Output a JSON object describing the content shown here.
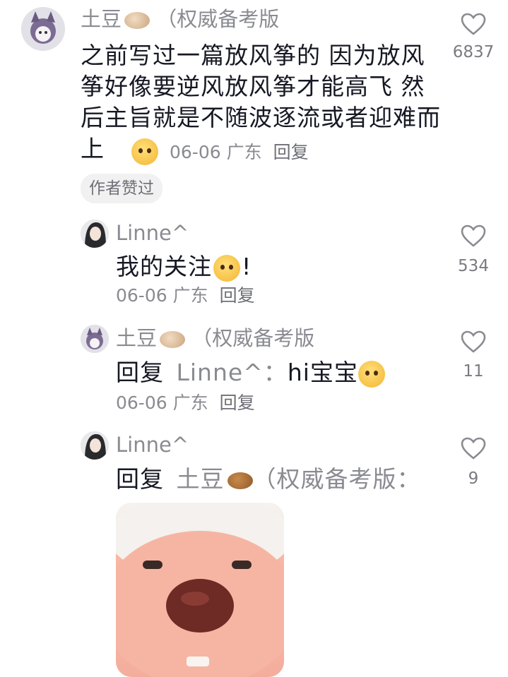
{
  "comments": [
    {
      "user": "土豆",
      "badge": "（权威备考版",
      "text": "之前写过一篇放风筝的 因为放风筝好像要逆风放风筝才能高飞 然后主旨就是不随波逐流或者迎难而上",
      "date": "06-06",
      "location": "广东",
      "reply_label": "回复",
      "tag": "作者赞过",
      "likes": "6837"
    },
    {
      "user": "Linne^",
      "text": "我的关注",
      "text_suffix": "!",
      "date": "06-06",
      "location": "广东",
      "reply_label": "回复",
      "likes": "534"
    },
    {
      "user": "土豆",
      "badge": "（权威备考版",
      "reply_prefix": "回复",
      "reply_target": "Linne^：",
      "text": "hi宝宝",
      "date": "06-06",
      "location": "广东",
      "reply_label": "回复",
      "likes": "11"
    },
    {
      "user": "Linne^",
      "reply_prefix": "回复",
      "reply_target": "土豆",
      "reply_target_badge": "（权威备考版：",
      "likes": "9"
    }
  ],
  "icons": {
    "heart": "heart-outline-icon",
    "potato": "potato-emoji-icon",
    "face": "cute-face-emoji-icon"
  }
}
